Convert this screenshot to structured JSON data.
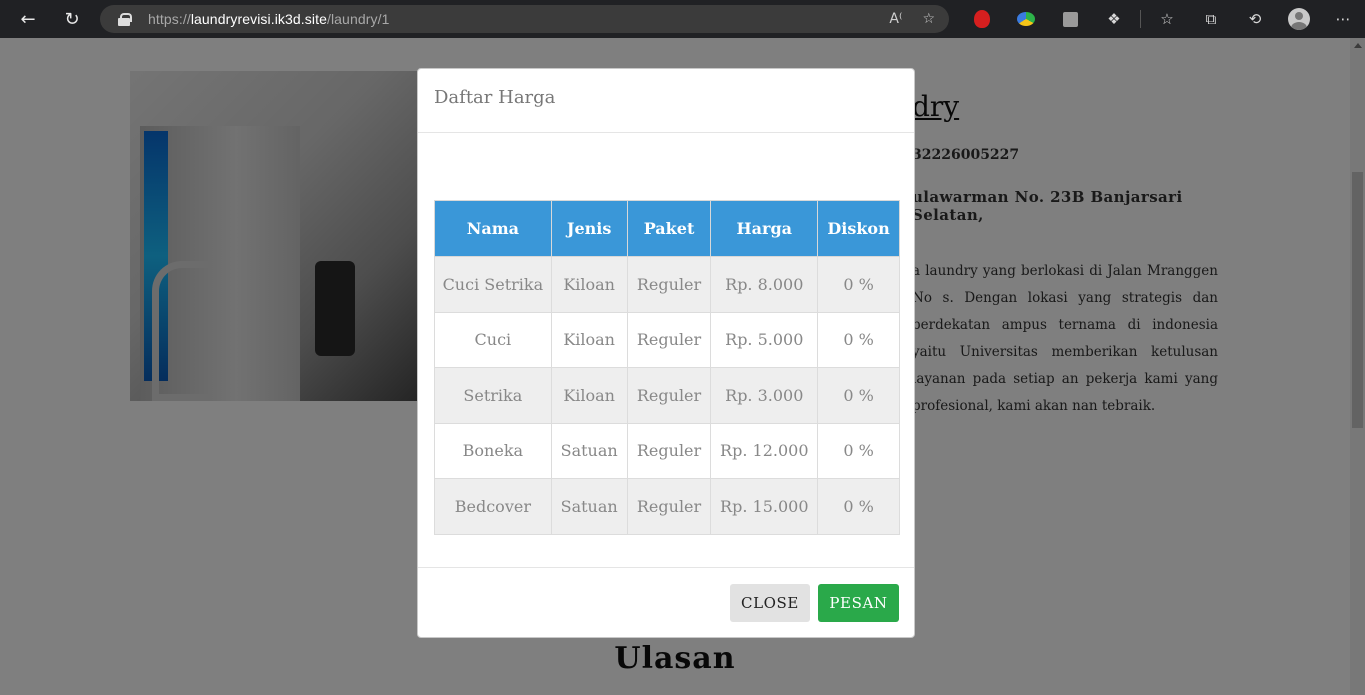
{
  "browser": {
    "url_prefix": "https://",
    "url_host": "laundryrevisi.ik3d.site",
    "url_path": "/laundry/1"
  },
  "page": {
    "title_fragment": "dry",
    "phone_fragment": "32226005227",
    "address_fragment": "ulawarman No. 23B Banjarsari Selatan,",
    "description_fragment": "a laundry yang berlokasi di Jalan Mranggen No s. Dengan lokasi yang strategis dan berdekatan ampus ternama di indonesia yaitu Universitas memberikan ketulusan layanan pada setiap an pekerja kami yang profesional, kami akan nan tebraik.",
    "ulasan": "Ulasan"
  },
  "modal": {
    "title": "Daftar Harga",
    "columns": [
      "Nama",
      "Jenis",
      "Paket",
      "Harga",
      "Diskon"
    ],
    "rows": [
      [
        "Cuci Setrika",
        "Kiloan",
        "Reguler",
        "Rp. 8.000",
        "0 %"
      ],
      [
        "Cuci",
        "Kiloan",
        "Reguler",
        "Rp. 5.000",
        "0 %"
      ],
      [
        "Setrika",
        "Kiloan",
        "Reguler",
        "Rp. 3.000",
        "0 %"
      ],
      [
        "Boneka",
        "Satuan",
        "Reguler",
        "Rp. 12.000",
        "0 %"
      ],
      [
        "Bedcover",
        "Satuan",
        "Reguler",
        "Rp. 15.000",
        "0 %"
      ]
    ],
    "close_label": "CLOSE",
    "pesan_label": "PESAN"
  },
  "colors": {
    "table_header": "#3a97d8",
    "pesan_button": "#2aa94a",
    "close_button": "#e2e2e2"
  }
}
